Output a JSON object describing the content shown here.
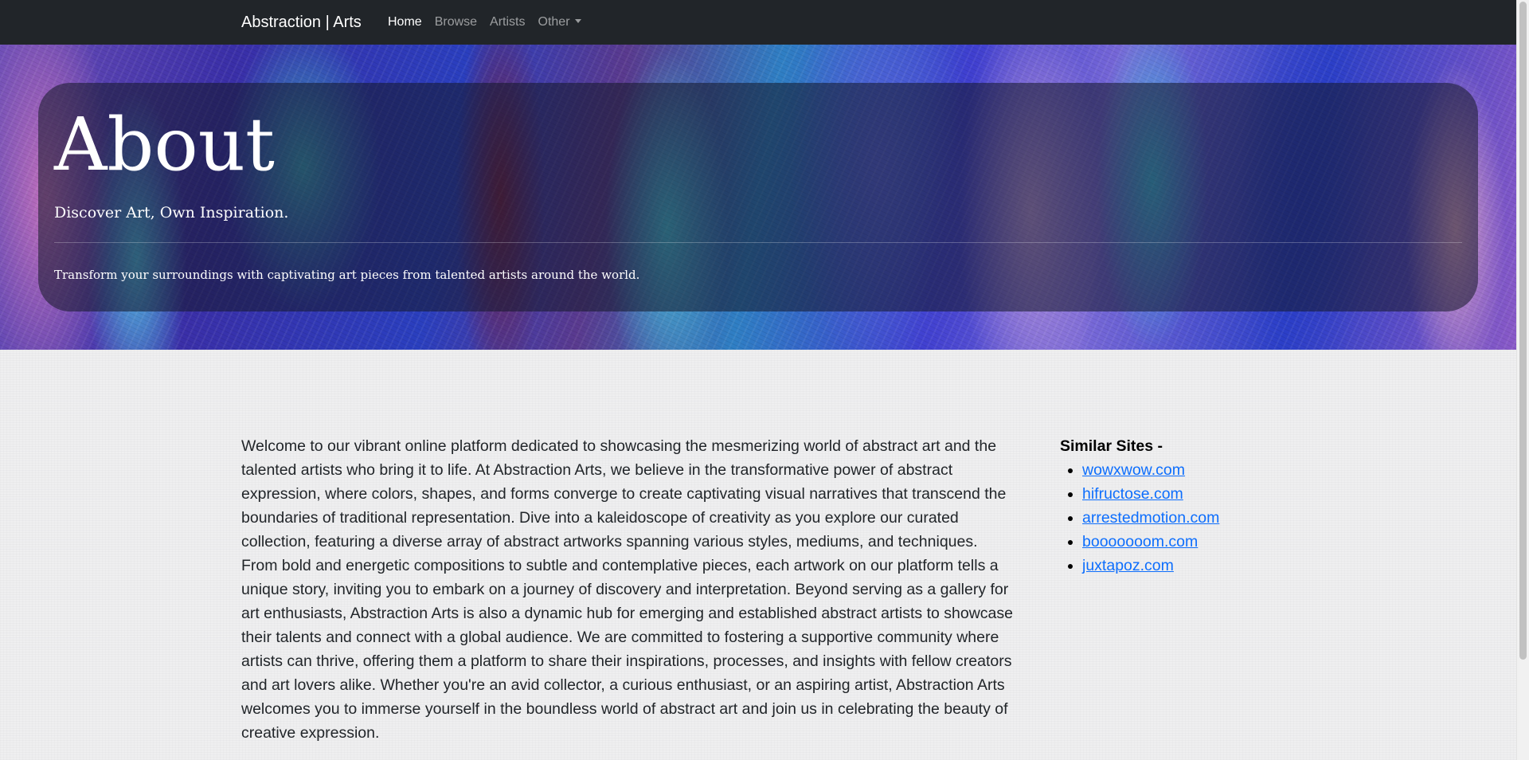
{
  "navbar": {
    "brand": "Abstraction | Arts",
    "links": [
      {
        "label": "Home"
      },
      {
        "label": "Browse"
      },
      {
        "label": "Artists"
      },
      {
        "label": "Other"
      }
    ]
  },
  "hero": {
    "title": "About",
    "subtitle": "Discover Art, Own Inspiration.",
    "lead": "Transform your surroundings with captivating art pieces from talented artists around the world."
  },
  "about": {
    "text": "Welcome to our vibrant online platform dedicated to showcasing the mesmerizing world of abstract art and the talented artists who bring it to life. At Abstraction Arts, we believe in the transformative power of abstract expression, where colors, shapes, and forms converge to create captivating visual narratives that transcend the boundaries of traditional representation. Dive into a kaleidoscope of creativity as you explore our curated collection, featuring a diverse array of abstract artworks spanning various styles, mediums, and techniques. From bold and energetic compositions to subtle and contemplative pieces, each artwork on our platform tells a unique story, inviting you to embark on a journey of discovery and interpretation. Beyond serving as a gallery for art enthusiasts, Abstraction Arts is also a dynamic hub for emerging and established abstract artists to showcase their talents and connect with a global audience. We are committed to fostering a supportive community where artists can thrive, offering them a platform to share their inspirations, processes, and insights with fellow creators and art lovers alike. Whether you're an avid collector, a curious enthusiast, or an aspiring artist, Abstraction Arts welcomes you to immerse yourself in the boundless world of abstract art and join us in celebrating the beauty of creative expression."
  },
  "similar_sites": {
    "heading": "Similar Sites -",
    "links": [
      {
        "label": "wowxwow.com"
      },
      {
        "label": "hifructose.com"
      },
      {
        "label": "arrestedmotion.com"
      },
      {
        "label": "booooooom.com"
      },
      {
        "label": "juxtapoz.com"
      }
    ]
  },
  "colors": {
    "navbar_bg": "#212529",
    "link": "#0d6efd"
  }
}
